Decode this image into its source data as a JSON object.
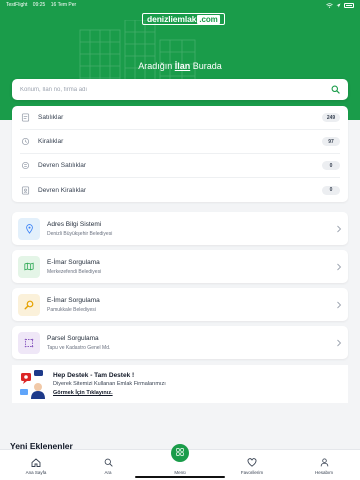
{
  "status_bar": {
    "carrier": "TestFlight",
    "time": "09:25",
    "date": "16 Tem Per"
  },
  "brand": {
    "logo_main": "denizliemlak",
    "logo_domain": ".com",
    "accent": "#1a9c4a"
  },
  "hero": {
    "prefix": "Aradığın",
    "highlight": "İlan",
    "suffix": "Burada"
  },
  "search": {
    "placeholder": "Konum, İlan no, firma adı",
    "icon": "search-icon"
  },
  "categories": [
    {
      "label": "Satılıklar",
      "count": "249",
      "icon": "tag-icon"
    },
    {
      "label": "Kiralıklar",
      "count": "97",
      "icon": "key-icon"
    },
    {
      "label": "Devren Satılıklar",
      "count": "0",
      "icon": "transfer-icon"
    },
    {
      "label": "Devren Kiralıklar",
      "count": "0",
      "icon": "document-icon"
    }
  ],
  "services": [
    {
      "title": "Adres Bilgi Sistemi",
      "subtitle": "Denizli Büyükşehir Belediyesi",
      "icon": "map-pin-icon",
      "bg": "#e3f0fb",
      "fg": "#3b82f6"
    },
    {
      "title": "E-İmar Sorgulama",
      "subtitle": "Merkezefendi Belediyesi",
      "icon": "map-icon",
      "bg": "#e4f5e7",
      "fg": "#22a34a"
    },
    {
      "title": "E-İmar Sorgulama",
      "subtitle": "Pamukkale Belediyesi",
      "icon": "magnifier-icon",
      "bg": "#fbf1da",
      "fg": "#e5a200"
    },
    {
      "title": "Parsel Sorgulama",
      "subtitle": "Tapu ve Kadastro Genel Md.",
      "icon": "parcel-icon",
      "bg": "#efe7f7",
      "fg": "#8b5cc0"
    }
  ],
  "promo": {
    "title": "Hep Destek - Tam Destek !",
    "description": "Diyerek Sitemizi Kullanan Emlak Firmalarımızı",
    "link": "Görmek İçin Tıklayınız."
  },
  "section_title": "Yeni Eklenenler",
  "tabs": [
    {
      "label": "Ana Sayfa",
      "icon": "home-icon"
    },
    {
      "label": "Ara",
      "icon": "search-icon"
    },
    {
      "label": "Menü",
      "icon": "grid-icon"
    },
    {
      "label": "Favorilerim",
      "icon": "heart-icon"
    },
    {
      "label": "Hesabım",
      "icon": "user-icon"
    }
  ]
}
